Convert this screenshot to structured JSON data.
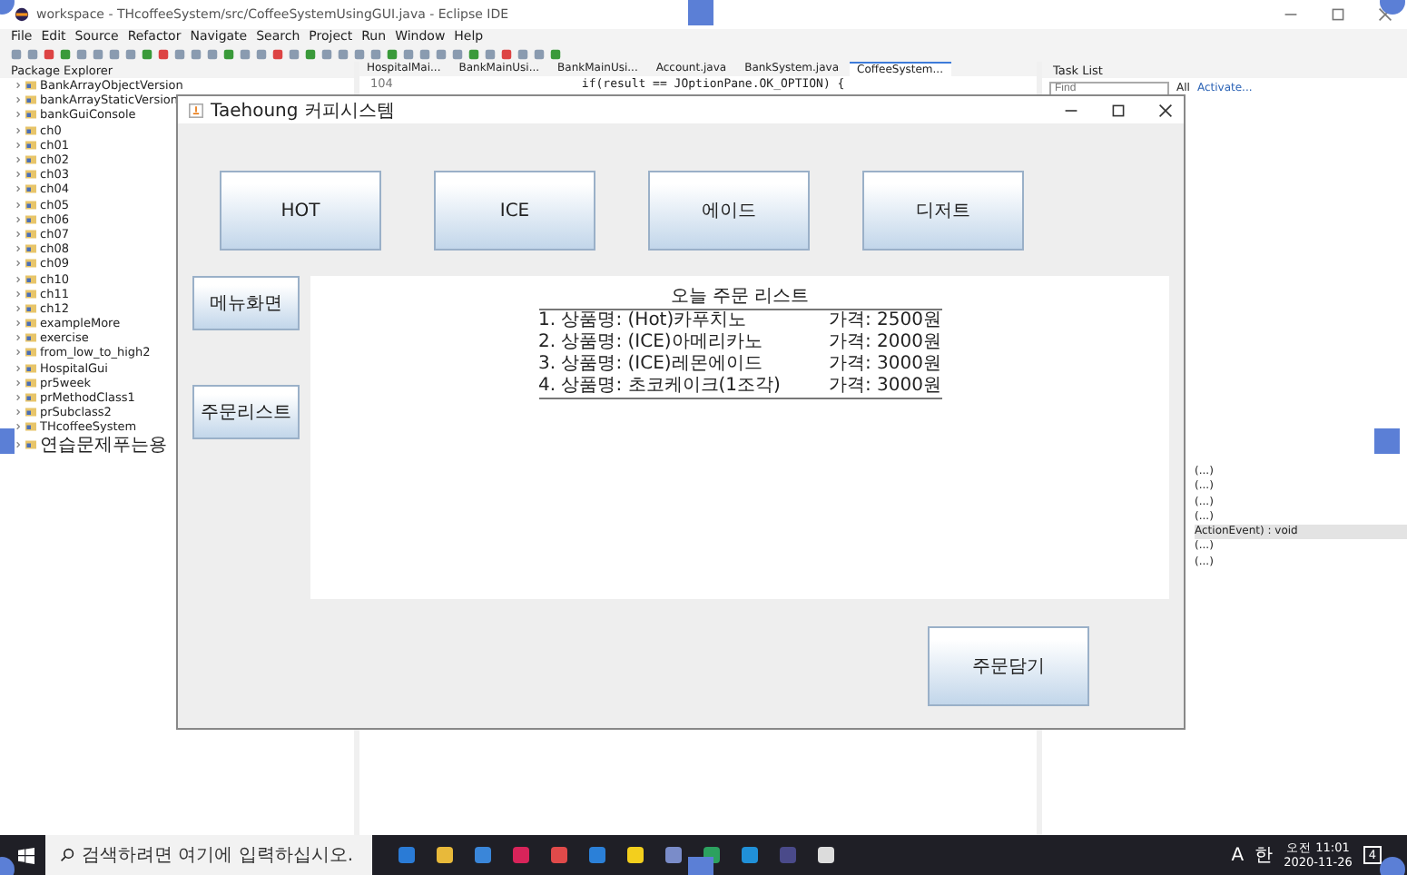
{
  "window": {
    "title": "workspace - THcoffeeSystem/src/CoffeeSystemUsingGUI.java - Eclipse IDE"
  },
  "menu": [
    "File",
    "Edit",
    "Source",
    "Refactor",
    "Navigate",
    "Search",
    "Project",
    "Run",
    "Window",
    "Help"
  ],
  "package_explorer": {
    "title": "Package Explorer",
    "items": [
      "BankArrayObjectVersion",
      "bankArrayStaticVersion",
      "bankGuiConsole",
      "ch0",
      "ch01",
      "ch02",
      "ch03",
      "ch04",
      "ch05",
      "ch06",
      "ch07",
      "ch08",
      "ch09",
      "ch10",
      "ch11",
      "ch12",
      "exampleMore",
      "exercise",
      "from_low_to_high2",
      "HospitalGui",
      "pr5week",
      "prMethodClass1",
      "prSubclass2",
      "THcoffeeSystem",
      "연습문제푸는용"
    ]
  },
  "editor": {
    "tabs": [
      {
        "label": "HospitalMai...",
        "selected": false
      },
      {
        "label": "BankMainUsi...",
        "selected": false
      },
      {
        "label": "BankMainUsi...",
        "selected": false
      },
      {
        "label": "Account.java",
        "selected": false
      },
      {
        "label": "BankSystem.java",
        "selected": false
      },
      {
        "label": "CoffeeSystem...",
        "selected": true
      }
    ],
    "line_number": "104",
    "code": "if(result == JOptionPane.OK_OPTION) {"
  },
  "task_list": {
    "title": "Task List",
    "find_placeholder": "Find",
    "filter": "All",
    "activate": "Activate..."
  },
  "outline": {
    "items": [
      "(...)",
      "(...)",
      "(...)",
      "(...)",
      "ActionEvent) : void",
      "(...)",
      "(...)"
    ]
  },
  "dialog": {
    "title": "Taehoung 커피시스템",
    "category_buttons": [
      "HOT",
      "ICE",
      "에이드",
      "디저트"
    ],
    "side_buttons": [
      "메뉴화면",
      "주문리스트"
    ],
    "order_list": {
      "title": "오늘 주문 리스트",
      "rows": [
        {
          "name": "1. 상품명: (Hot)카푸치노",
          "price": "가격: 2500원"
        },
        {
          "name": "2. 상품명: (ICE)아메리카노",
          "price": "가격: 2000원"
        },
        {
          "name": "3. 상품명: (ICE)레몬에이드",
          "price": "가격: 3000원"
        },
        {
          "name": "4. 상품명: 초코케이크(1조각)",
          "price": "가격: 3000원"
        }
      ]
    },
    "add_button": "주문담기"
  },
  "taskbar": {
    "search_placeholder": "검색하려면 여기에 입력하십시오.",
    "ime": [
      "A",
      "한"
    ],
    "time": "오전 11:01",
    "date": "2020-11-26",
    "notification_count": "4"
  }
}
